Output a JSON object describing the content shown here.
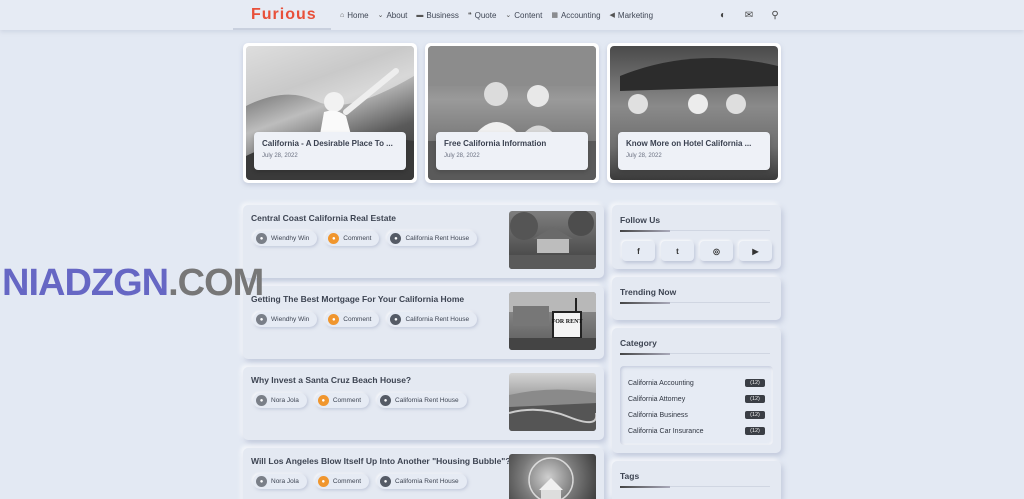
{
  "header": {
    "logo": "Furious",
    "nav": [
      {
        "icon": "home-icon",
        "glyph": "⌂",
        "label": "Home"
      },
      {
        "icon": "chevron-down-icon",
        "glyph": "⌄",
        "label": "About"
      },
      {
        "icon": "briefcase-icon",
        "glyph": "▬",
        "label": "Business"
      },
      {
        "icon": "quote-icon",
        "glyph": "❝",
        "label": "Quote"
      },
      {
        "icon": "chevron-down-icon",
        "glyph": "⌄",
        "label": "Content"
      },
      {
        "icon": "calculator-icon",
        "glyph": "▦",
        "label": "Accounting"
      },
      {
        "icon": "megaphone-icon",
        "glyph": "◀",
        "label": "Marketing"
      }
    ],
    "tools": [
      {
        "icon": "theme-toggle-icon",
        "glyph": "◐"
      },
      {
        "icon": "mail-icon",
        "glyph": "✉"
      },
      {
        "icon": "search-icon",
        "glyph": "⚲"
      }
    ]
  },
  "featured": [
    {
      "title": "California - A Desirable Place To ...",
      "date": "July 28, 2022"
    },
    {
      "title": "Free California Information",
      "date": "July 28, 2022"
    },
    {
      "title": "Know More on Hotel California ...",
      "date": "July 28, 2022"
    }
  ],
  "posts": [
    {
      "title": "Central Coast California Real Estate",
      "author": "Wiendhy Win",
      "comment": "Comment",
      "category": "California Rent House"
    },
    {
      "title": "Getting The Best Mortgage For Your California Home",
      "author": "Wiendhy Win",
      "comment": "Comment",
      "category": "California Rent House",
      "thumb_text": "FOR RENT"
    },
    {
      "title": "Why Invest a Santa Cruz Beach House?",
      "author": "Nora Jola",
      "comment": "Comment",
      "category": "California Rent House"
    },
    {
      "title": "Will Los Angeles Blow Itself Up Into Another \"Housing Bubble\"?",
      "author": "Nora Jola",
      "comment": "Comment",
      "category": "California Rent House"
    }
  ],
  "sidebar": {
    "follow": {
      "title": "Follow Us",
      "links": [
        {
          "icon": "facebook-icon",
          "glyph": "f"
        },
        {
          "icon": "twitter-icon",
          "glyph": "t"
        },
        {
          "icon": "instagram-icon",
          "glyph": "◎"
        },
        {
          "icon": "youtube-icon",
          "glyph": "▶"
        }
      ]
    },
    "trending": {
      "title": "Trending Now"
    },
    "category": {
      "title": "Category",
      "items": [
        {
          "name": "California Accounting",
          "count": "(12)"
        },
        {
          "name": "California Attorney",
          "count": "(12)"
        },
        {
          "name": "California Business",
          "count": "(12)"
        },
        {
          "name": "California Car Insurance",
          "count": "(12)"
        }
      ]
    },
    "tags": {
      "title": "Tags"
    }
  },
  "watermark": {
    "part1": "NIADZGN",
    "part2": ".COM"
  }
}
